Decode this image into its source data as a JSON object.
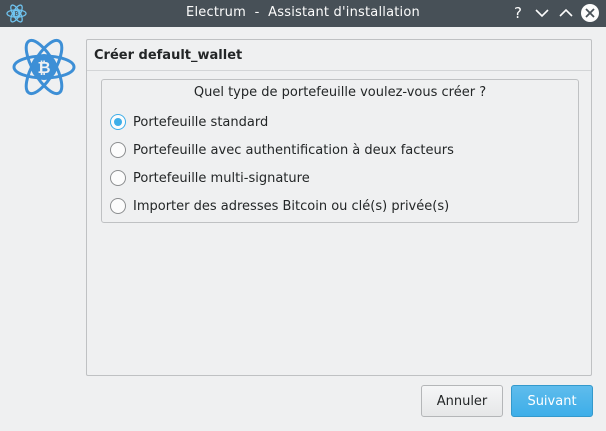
{
  "window": {
    "title": "Electrum  -  Assistant d'installation",
    "help_glyph": "?"
  },
  "panel": {
    "title": "Créer default_wallet"
  },
  "wallet_type": {
    "question": "Quel type de portefeuille voulez-vous créer ?",
    "options": [
      {
        "label": "Portefeuille standard",
        "checked": true
      },
      {
        "label": "Portefeuille avec authentification à deux facteurs",
        "checked": false
      },
      {
        "label": "Portefeuille multi-signature",
        "checked": false
      },
      {
        "label": "Importer des adresses Bitcoin ou clé(s) privée(s)",
        "checked": false
      }
    ]
  },
  "buttons": {
    "cancel": "Annuler",
    "next": "Suivant"
  },
  "icons": {
    "app": "electrum-logo-icon",
    "help": "help-icon",
    "minimize": "minimize-icon",
    "maximize": "maximize-icon",
    "close": "close-icon"
  },
  "colors": {
    "titlebar": "#475057",
    "accent": "#3daee9",
    "window_bg": "#eff0f1"
  }
}
